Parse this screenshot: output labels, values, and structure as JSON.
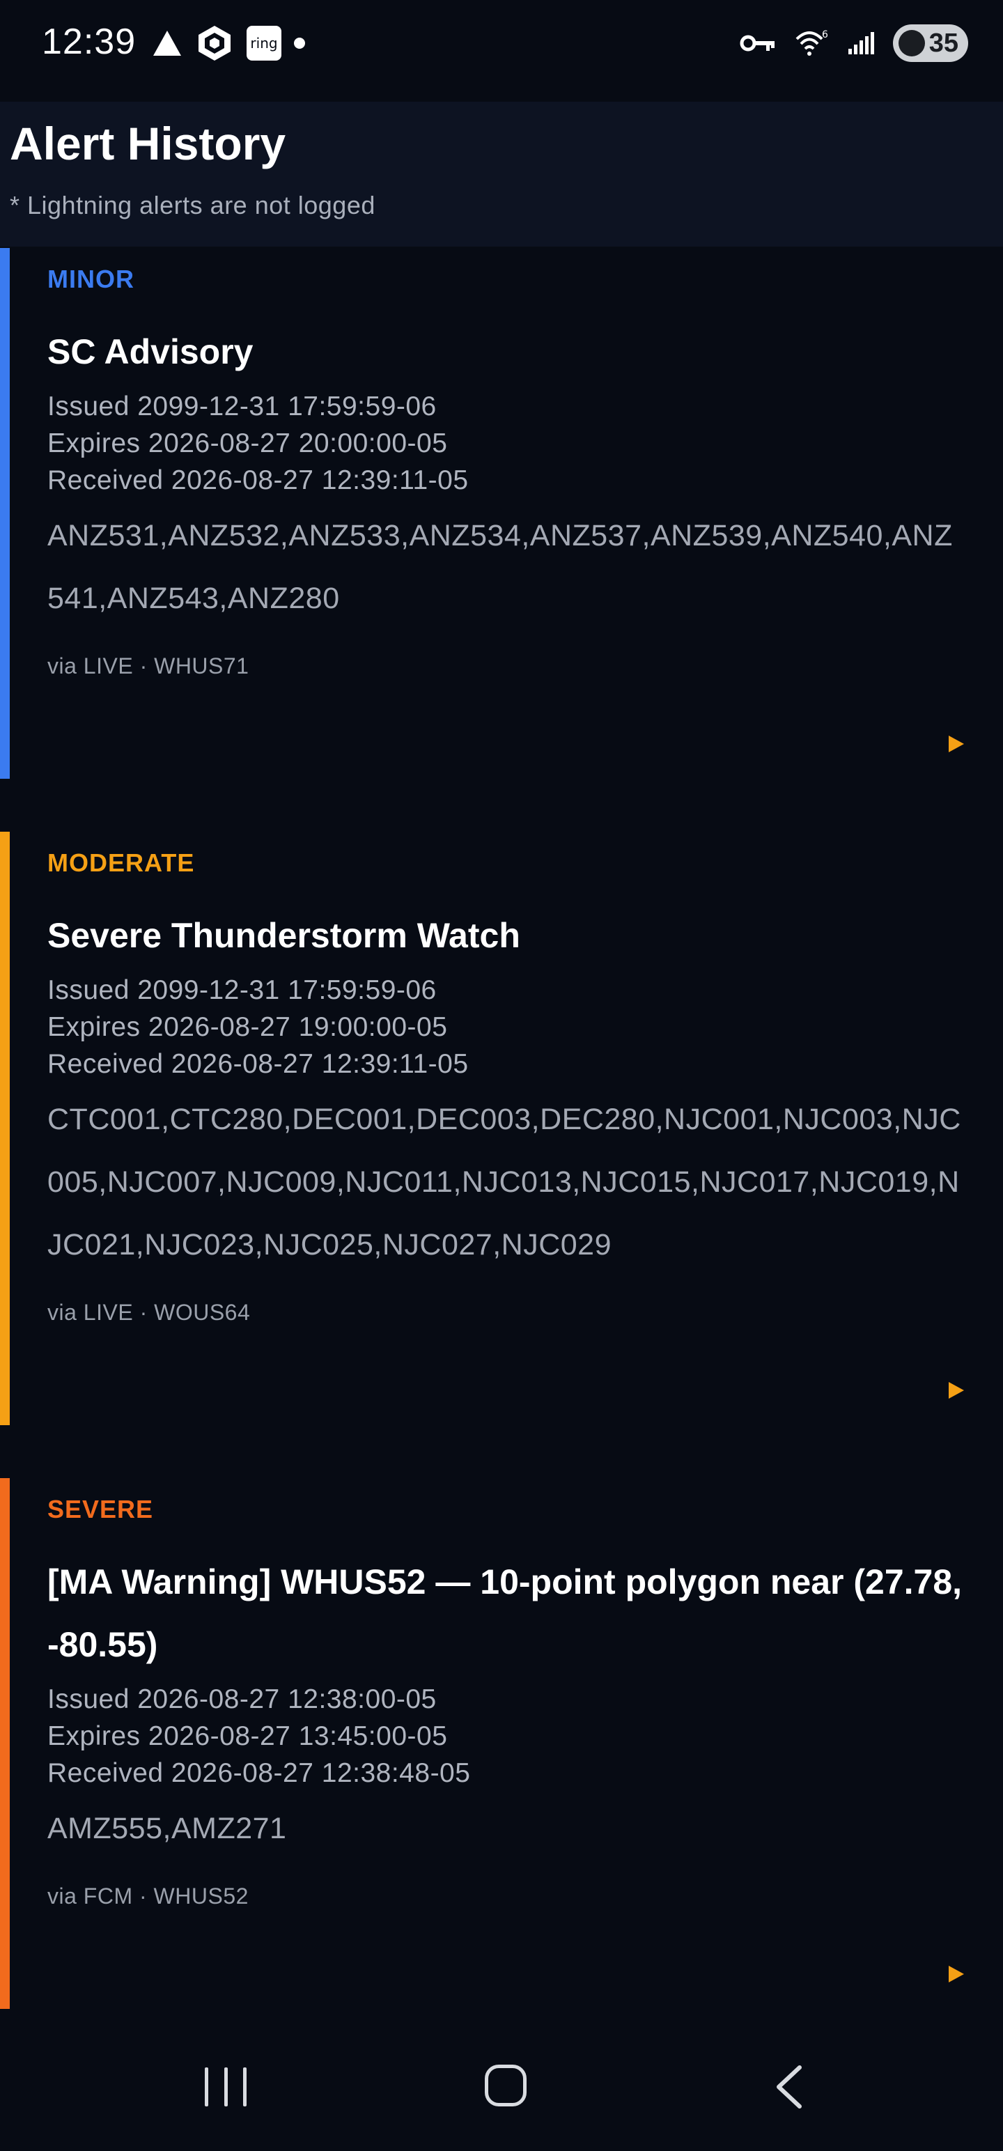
{
  "status_bar": {
    "time": "12:39",
    "ring_label": "ring",
    "battery": "35",
    "icons": [
      "warning-triangle-icon",
      "crypto-app-icon",
      "ring-app-icon",
      "notification-dot-icon",
      "vpn-key-icon",
      "wifi-6-icon",
      "cell-signal-icon",
      "battery-saver-icon"
    ]
  },
  "header": {
    "title": "Alert History",
    "subtitle": "* Lightning alerts are not logged"
  },
  "colors": {
    "minor": "#3b7bf0",
    "moderate": "#f5a015",
    "severe": "#f26b1d",
    "play": "#f5a015"
  },
  "alerts": [
    {
      "severity": "MINOR",
      "title": "SC Advisory",
      "issued": "Issued 2099-12-31 17:59:59-06",
      "expires": "Expires 2026-08-27 20:00:00-05",
      "received": "Received 2026-08-27 12:39:11-05",
      "zones": "ANZ531,ANZ532,ANZ533,ANZ534,ANZ537,ANZ539,ANZ540,ANZ541,ANZ543,ANZ280",
      "source": "via LIVE · WHUS71"
    },
    {
      "severity": "MODERATE",
      "title": "Severe Thunderstorm Watch",
      "issued": "Issued 2099-12-31 17:59:59-06",
      "expires": "Expires 2026-08-27 19:00:00-05",
      "received": "Received 2026-08-27 12:39:11-05",
      "zones": "CTC001,CTC280,DEC001,DEC003,DEC280,NJC001,NJC003,NJC005,NJC007,NJC009,NJC011,NJC013,NJC015,NJC017,NJC019,NJC021,NJC023,NJC025,NJC027,NJC029",
      "source": "via LIVE · WOUS64"
    },
    {
      "severity": "SEVERE",
      "title": "[MA Warning] WHUS52 — 10-point polygon near (27.78, -80.55)",
      "issued": "Issued 2026-08-27 12:38:00-05",
      "expires": "Expires 2026-08-27 13:45:00-05",
      "received": "Received 2026-08-27 12:38:48-05",
      "zones": "AMZ555,AMZ271",
      "source": "via FCM · WHUS52"
    }
  ]
}
